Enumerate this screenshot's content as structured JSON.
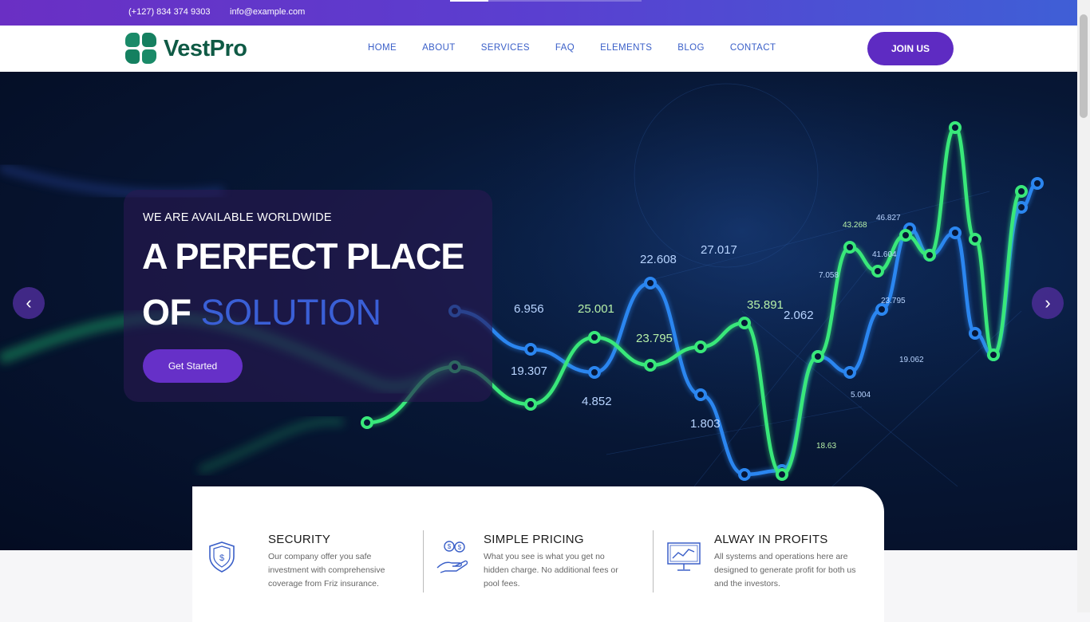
{
  "topbar": {
    "phone": "(+127) 834 374 9303",
    "email": "info@example.com",
    "progress": 0.2
  },
  "brand": {
    "name": "VestPro",
    "color": "#0f5a45"
  },
  "nav": {
    "items": [
      "HOME",
      "ABOUT",
      "SERVICES",
      "FAQ",
      "ELEMENTS",
      "BLOG",
      "CONTACT"
    ],
    "cta": "JOIN US",
    "accent": "#5e2bc2"
  },
  "hero": {
    "eyebrow": "WE ARE AVAILABLE WORLDWIDE",
    "title_line1": "A PERFECT PLACE",
    "title_line2_prefix": "OF ",
    "title_line2_accent": "SOLUTION",
    "button": "Get Started",
    "prev_icon": "chevron-left-icon",
    "next_icon": "chevron-right-icon",
    "bg_labels": [
      "6.956",
      "25.001",
      "22.608",
      "27.017",
      "35.891",
      "23.795",
      "19.307",
      "4.852",
      "1.803",
      "2.062",
      "7.058",
      "43.268",
      "46.827",
      "41.604",
      "23.795",
      "19.062",
      "5.004",
      "18.63"
    ]
  },
  "features": [
    {
      "icon": "shield-icon",
      "title": "SECURITY",
      "text": "Our company offer you safe investment with comprehensive coverage from Friz insurance."
    },
    {
      "icon": "coins-hand-icon",
      "title": "SIMPLE PRICING",
      "text": "What you see is what you get no hidden charge. No additional fees or pool fees."
    },
    {
      "icon": "chart-monitor-icon",
      "title": "ALWAY IN PROFITS",
      "text": "All systems and operations here are designed to generate profit for both us and the investors."
    }
  ]
}
